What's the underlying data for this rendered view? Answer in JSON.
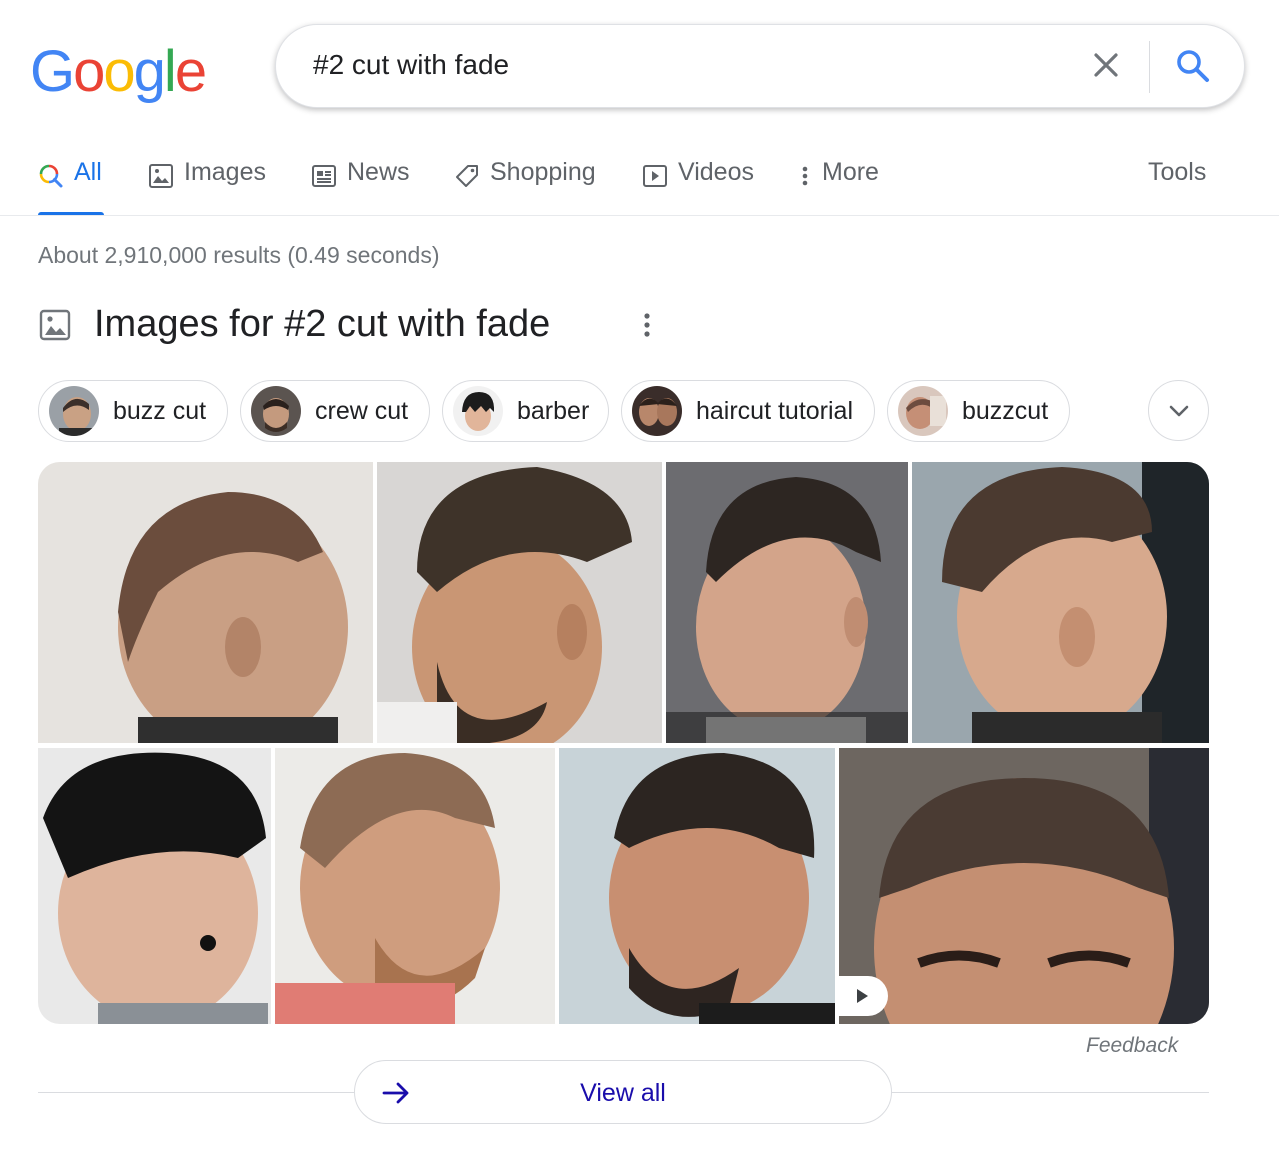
{
  "header": {
    "logo_letters": [
      "G",
      "o",
      "o",
      "g",
      "l",
      "e"
    ],
    "search_query": "#2 cut with fade",
    "clear_icon": "close-icon",
    "search_icon": "search-icon"
  },
  "tabs": [
    {
      "label": "All",
      "icon": "search-icon",
      "active": true
    },
    {
      "label": "Images",
      "icon": "image-icon",
      "active": false
    },
    {
      "label": "News",
      "icon": "news-icon",
      "active": false
    },
    {
      "label": "Shopping",
      "icon": "tag-icon",
      "active": false
    },
    {
      "label": "Videos",
      "icon": "play-icon",
      "active": false
    },
    {
      "label": "More",
      "icon": "kebab-icon",
      "active": false
    },
    {
      "label": "Tools",
      "icon": "",
      "active": false
    }
  ],
  "results_stats": "About 2,910,000 results (0.49 seconds)",
  "images_section": {
    "title": "Images for #2 cut with fade",
    "chips": [
      {
        "label": "buzz cut"
      },
      {
        "label": "crew cut"
      },
      {
        "label": "barber"
      },
      {
        "label": "haircut tutorial"
      },
      {
        "label": "buzzcut"
      }
    ],
    "feedback": "Feedback",
    "view_all": "View all"
  },
  "colors": {
    "accent_blue": "#1a73e8",
    "link_blue": "#1a0dab",
    "text_gray": "#70757a",
    "border": "#dadce0"
  }
}
